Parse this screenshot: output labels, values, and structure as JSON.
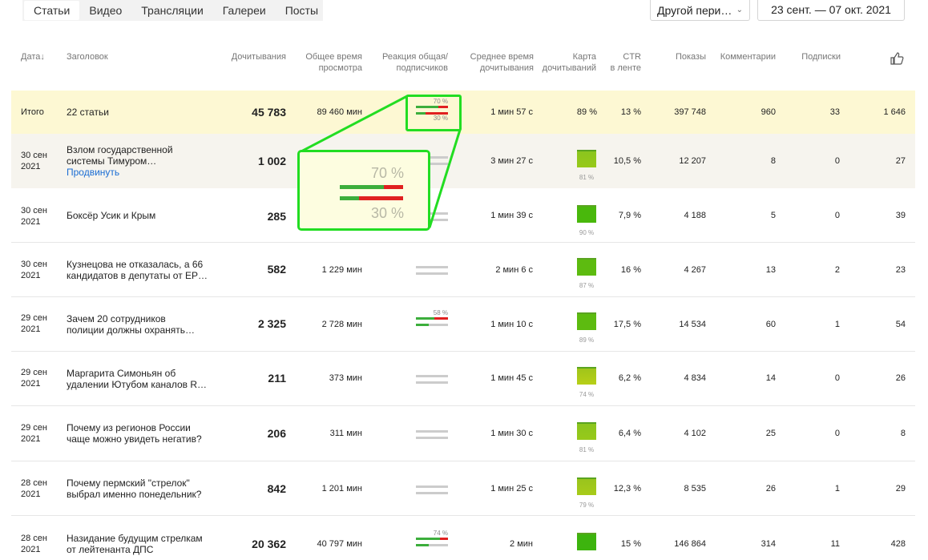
{
  "tabs": [
    "Статьи",
    "Видео",
    "Трансляции",
    "Галереи",
    "Посты"
  ],
  "period": "Другой пери…",
  "date_range": "23 сент. — 07 окт. 2021",
  "headers": {
    "date": "Дата",
    "title": "Заголовок",
    "reads": "Дочитывания",
    "total_time_1": "Общее время",
    "total_time_2": "просмотра",
    "reaction_1": "Реакция общая/",
    "reaction_2": "подписчиков",
    "avg_time_1": "Среднее время",
    "avg_time_2": "дочитывания",
    "map_1": "Карта",
    "map_2": "дочитываний",
    "ctr_1": "CTR",
    "ctr_2": "в ленте",
    "shows": "Показы",
    "comments": "Комментарии",
    "subs": "Подписки"
  },
  "total": {
    "label": "Итого",
    "title": "22 статьи",
    "reads": "45 783",
    "time": "89 460 мин",
    "react_top": "70 %",
    "react_bottom": "30 %",
    "avg": "1 мин 57 с",
    "pct": "89 %",
    "ctr": "13 %",
    "shows": "397 748",
    "comments": "960",
    "subs": "33",
    "likes": "1 646"
  },
  "zoom": {
    "top": "70 %",
    "bottom": "30 %"
  },
  "promote_label": "Продвинуть",
  "rows": [
    {
      "d1": "30 сен",
      "d2": "2021",
      "t1": "Взлом государственной",
      "t2": "системы Тимуром…",
      "reads": "1 002",
      "time": "",
      "avg": "3 мин 27 с",
      "map": "81 %",
      "ctr": "10,5 %",
      "shows": "12 207",
      "comments": "8",
      "subs": "0",
      "likes": "27"
    },
    {
      "d1": "30 сен",
      "d2": "2021",
      "t1": "Боксёр Усик и Крым",
      "t2": "",
      "reads": "285",
      "time": "",
      "avg": "1 мин 39 с",
      "map": "90 %",
      "ctr": "7,9 %",
      "shows": "4 188",
      "comments": "5",
      "subs": "0",
      "likes": "39"
    },
    {
      "d1": "30 сен",
      "d2": "2021",
      "t1": "Кузнецова не отказалась, а 66",
      "t2": "кандидатов в депутаты от ЕР…",
      "reads": "582",
      "time": "1 229 мин",
      "avg": "2 мин 6 с",
      "map": "87 %",
      "ctr": "16 %",
      "shows": "4 267",
      "comments": "13",
      "subs": "2",
      "likes": "23"
    },
    {
      "d1": "29 сен",
      "d2": "2021",
      "t1": "Зачем 20 сотрудников",
      "t2": "полиции должны охранять…",
      "reads": "2 325",
      "time": "2 728 мин",
      "react": "58 %",
      "avg": "1 мин 10 с",
      "map": "89 %",
      "ctr": "17,5 %",
      "shows": "14 534",
      "comments": "60",
      "subs": "1",
      "likes": "54"
    },
    {
      "d1": "29 сен",
      "d2": "2021",
      "t1": "Маргарита Симоньян об",
      "t2": "удалении Ютубом каналов R…",
      "reads": "211",
      "time": "373 мин",
      "avg": "1 мин 45 с",
      "map": "74 %",
      "ctr": "6,2 %",
      "shows": "4 834",
      "comments": "14",
      "subs": "0",
      "likes": "26"
    },
    {
      "d1": "29 сен",
      "d2": "2021",
      "t1": "Почему из регионов России",
      "t2": "чаще можно увидеть негатив?",
      "reads": "206",
      "time": "311 мин",
      "avg": "1 мин 30 с",
      "map": "81 %",
      "ctr": "6,4 %",
      "shows": "4 102",
      "comments": "25",
      "subs": "0",
      "likes": "8"
    },
    {
      "d1": "28 сен",
      "d2": "2021",
      "t1": "Почему пермский \"стрелок\"",
      "t2": "выбрал именно понедельник?",
      "reads": "842",
      "time": "1 201 мин",
      "avg": "1 мин 25 с",
      "map": "79 %",
      "ctr": "12,3 %",
      "shows": "8 535",
      "comments": "26",
      "subs": "1",
      "likes": "29"
    },
    {
      "d1": "28 сен",
      "d2": "2021",
      "t1": "Назидание будущим стрелкам",
      "t2": "от лейтенанта ДПС",
      "reads": "20 362",
      "time": "40 797 мин",
      "react": "74 %",
      "avg": "2 мин",
      "map": "",
      "ctr": "15 %",
      "shows": "146 864",
      "comments": "314",
      "subs": "11",
      "likes": "428"
    }
  ]
}
